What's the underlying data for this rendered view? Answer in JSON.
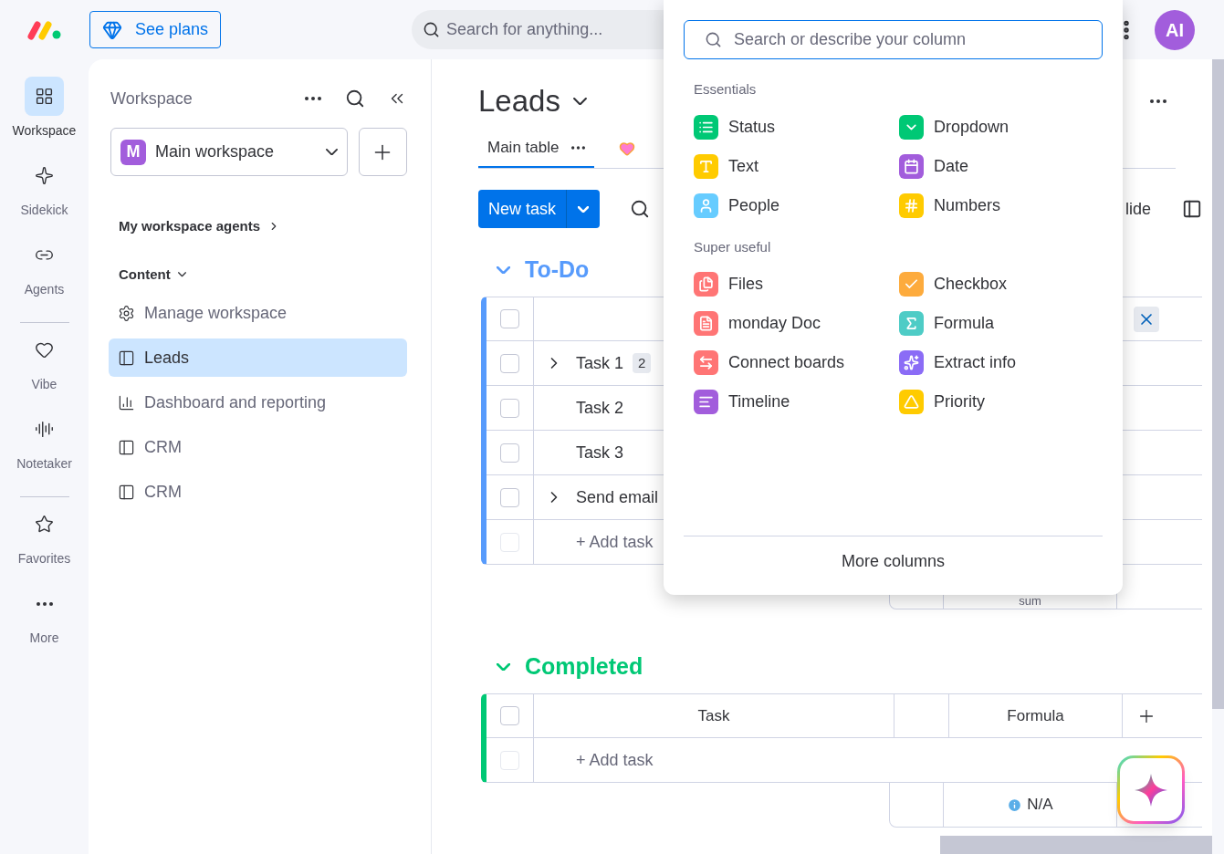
{
  "topbar": {
    "plans_button": "See plans",
    "search": {
      "placeholder": "Search for anything..."
    },
    "avatar": "AI"
  },
  "rail": [
    {
      "items": [
        {
          "label": "Workspace",
          "kind": "workspace",
          "selected": true
        },
        {
          "label": "Sidekick",
          "kind": "sidekick",
          "selected": false
        },
        {
          "label": "Agents",
          "kind": "agents",
          "selected": false
        }
      ]
    },
    {
      "items": [
        {
          "label": "Vibe",
          "kind": "vibe",
          "selected": false
        },
        {
          "label": "Notetaker",
          "kind": "notetaker",
          "selected": false
        }
      ]
    },
    {
      "items": [
        {
          "label": "Favorites",
          "kind": "favorites",
          "selected": false
        },
        {
          "label": "More",
          "kind": "more",
          "selected": false
        }
      ]
    }
  ],
  "sidebar": {
    "title": "Workspace",
    "workspace": {
      "initial": "M",
      "name": "Main workspace"
    },
    "agents_link": "My workspace agents",
    "section": "Content",
    "items": [
      {
        "label": "Manage workspace",
        "kind": "settings",
        "selected": false
      },
      {
        "label": "Leads",
        "kind": "board",
        "selected": true
      },
      {
        "label": "Dashboard and reporting",
        "kind": "dashboard",
        "selected": false
      },
      {
        "label": "CRM",
        "kind": "board",
        "selected": false
      },
      {
        "label": "CRM",
        "kind": "board",
        "selected": false
      }
    ]
  },
  "board": {
    "title": "Leads",
    "tabs": [
      {
        "label": "Main table",
        "selected": true
      }
    ],
    "new_task": "New task",
    "hide_partial": "lide",
    "groups": [
      {
        "name": "To-Do",
        "color": "#579bfc",
        "add_column_open": true,
        "header_checked": false,
        "rows": [
          {
            "name": "Task 1",
            "expandable": true,
            "subitems": "2",
            "checked": false
          },
          {
            "name": "Task 2",
            "expandable": false,
            "checked": false
          },
          {
            "name": "Task 3",
            "expandable": false,
            "checked": false
          },
          {
            "name": "Send email",
            "expandable": true,
            "checked": false
          }
        ],
        "add_task": "+ Add task",
        "add_checked": false,
        "footer": {
          "text": "sum",
          "warning": false
        }
      },
      {
        "name": "Completed",
        "color": "#00c875",
        "add_column_open": false,
        "header_checked": false,
        "columns": {
          "task": "Task",
          "formula": "Formula"
        },
        "add_task": "+ Add task",
        "add_checked": false,
        "footer": {
          "text": "N/A",
          "warning": true
        }
      }
    ]
  },
  "column_picker": {
    "search": {
      "placeholder": "Search or describe your column"
    },
    "sections": [
      {
        "title": "Essentials",
        "items": [
          {
            "label": "Status",
            "kind": "status",
            "color": "#00c875"
          },
          {
            "label": "Dropdown",
            "kind": "dropdown",
            "color": "#00c875"
          },
          {
            "label": "Text",
            "kind": "text",
            "color": "#ffcb00"
          },
          {
            "label": "Date",
            "kind": "date",
            "color": "#a25ddc"
          },
          {
            "label": "People",
            "kind": "people",
            "color": "#66ccff"
          },
          {
            "label": "Numbers",
            "kind": "numbers",
            "color": "#ffcb00"
          }
        ]
      },
      {
        "title": "Super useful",
        "items": [
          {
            "label": "Files",
            "kind": "files",
            "color": "#ff7575"
          },
          {
            "label": "Checkbox",
            "kind": "checkbox",
            "color": "#fdab3d"
          },
          {
            "label": "monday Doc",
            "kind": "doc",
            "color": "#ff7575"
          },
          {
            "label": "Formula",
            "kind": "formula",
            "color": "#4eccc6"
          },
          {
            "label": "Connect boards",
            "kind": "connect",
            "color": "#ff7575"
          },
          {
            "label": "Extract info",
            "kind": "extract",
            "color": "#8b6cf6"
          },
          {
            "label": "Timeline",
            "kind": "timeline",
            "color": "#a25ddc"
          },
          {
            "label": "Priority",
            "kind": "priority",
            "color": "#ffcb00"
          }
        ]
      }
    ],
    "more_button": "More columns"
  }
}
